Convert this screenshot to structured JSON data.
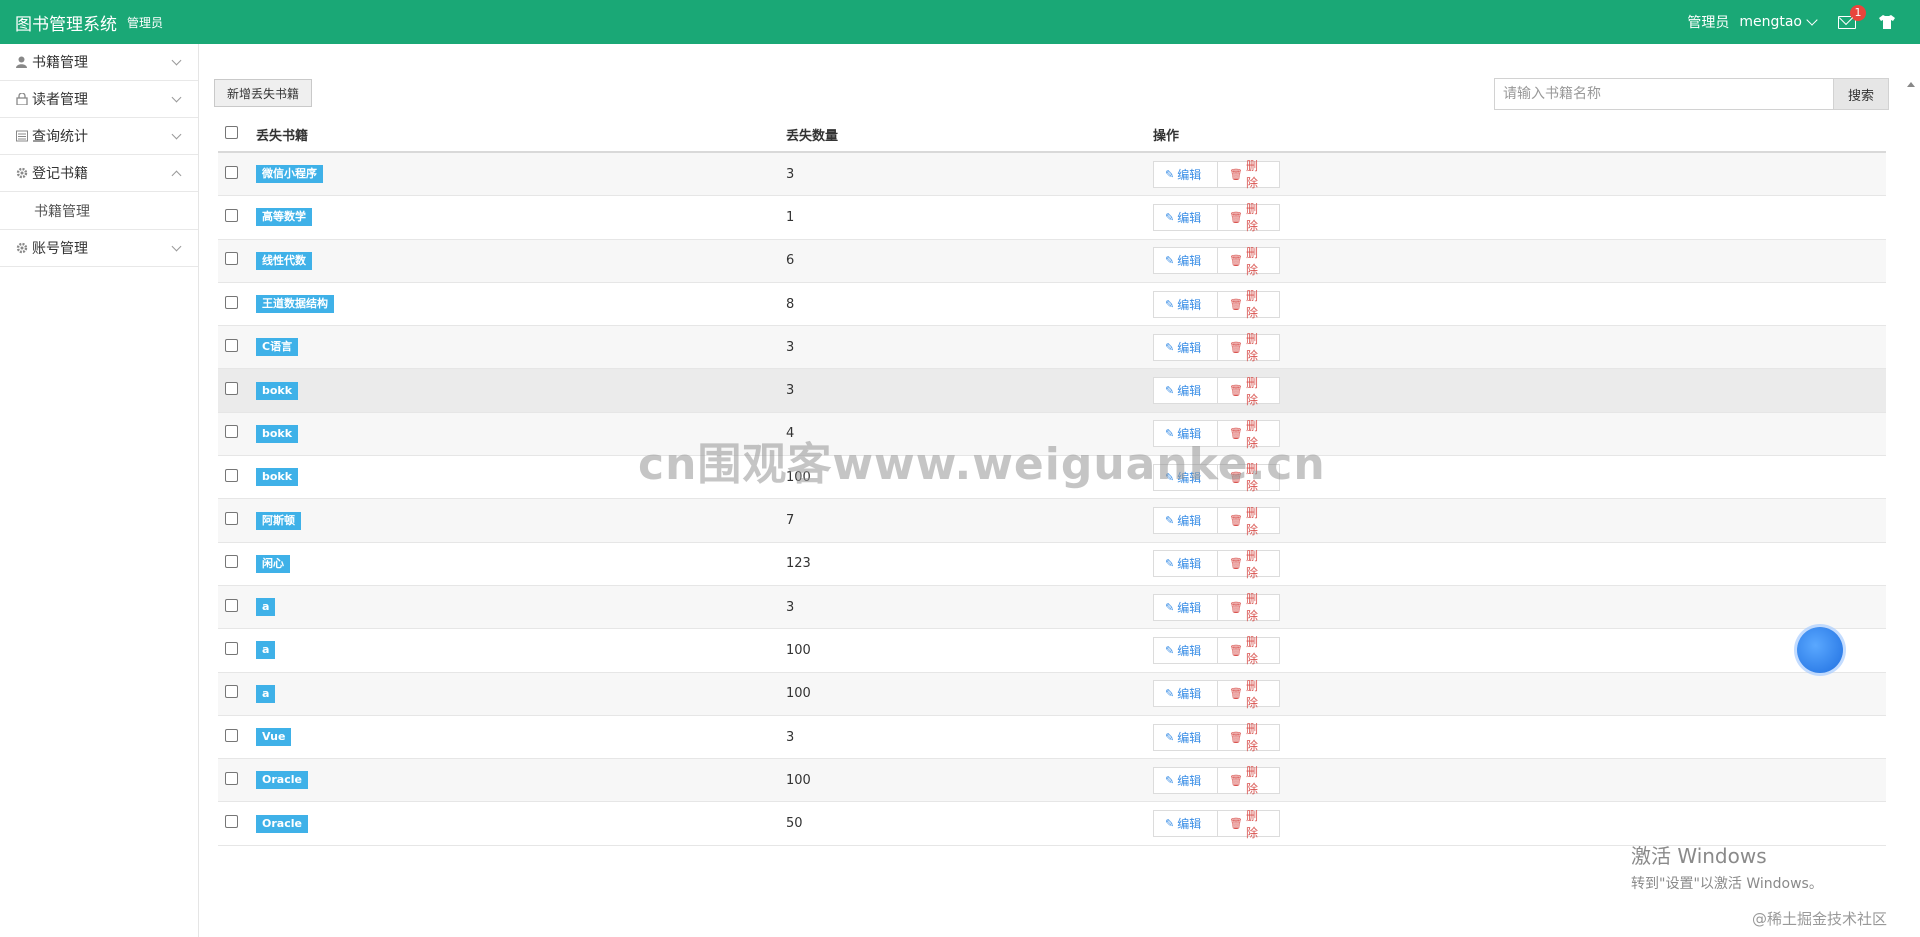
{
  "header": {
    "brand": "图书管理系统",
    "brand_sub": "管理员",
    "role": "管理员",
    "username": "mengtao",
    "mail_badge": "1",
    "bg_color": "#1aa876"
  },
  "sidebar": {
    "items": [
      {
        "label": "书籍管理",
        "icon": "user-icon"
      },
      {
        "label": "读者管理",
        "icon": "lock-icon"
      },
      {
        "label": "查询统计",
        "icon": "chart-icon"
      },
      {
        "label": "登记书籍",
        "icon": "gear-icon"
      },
      {
        "label": "账号管理",
        "icon": "gear-icon"
      }
    ],
    "subitems": [
      {
        "label": "书籍管理"
      }
    ]
  },
  "toolbar": {
    "add_label": "新增丢失书籍",
    "search_placeholder": "请输入书籍名称",
    "search_label": "搜索"
  },
  "table": {
    "headers": [
      "丢失书籍",
      "丢失数量",
      "操作"
    ],
    "edit_label": "编辑",
    "delete_label": "删除",
    "rows": [
      {
        "name": "微信小程序",
        "count": "3"
      },
      {
        "name": "高等数学",
        "count": "1"
      },
      {
        "name": "线性代数",
        "count": "6"
      },
      {
        "name": "王道数据结构",
        "count": "8"
      },
      {
        "name": "C语言",
        "count": "3"
      },
      {
        "name": "bokk",
        "count": "3"
      },
      {
        "name": "bokk",
        "count": "4"
      },
      {
        "name": "bokk",
        "count": "100"
      },
      {
        "name": "阿斯顿",
        "count": "7"
      },
      {
        "name": "闲心",
        "count": "123"
      },
      {
        "name": "a",
        "count": "3"
      },
      {
        "name": "a",
        "count": "100"
      },
      {
        "name": "a",
        "count": "100"
      },
      {
        "name": "Vue",
        "count": "3"
      },
      {
        "name": "Oracle",
        "count": "100"
      },
      {
        "name": "Oracle",
        "count": "50"
      }
    ]
  },
  "overlay": {
    "watermark": "cn围观客www.weiguanke.cn",
    "activate_title": "激活 Windows",
    "activate_sub": "转到\"设置\"以激活 Windows。",
    "juejin": "@稀土掘金技术社区"
  }
}
